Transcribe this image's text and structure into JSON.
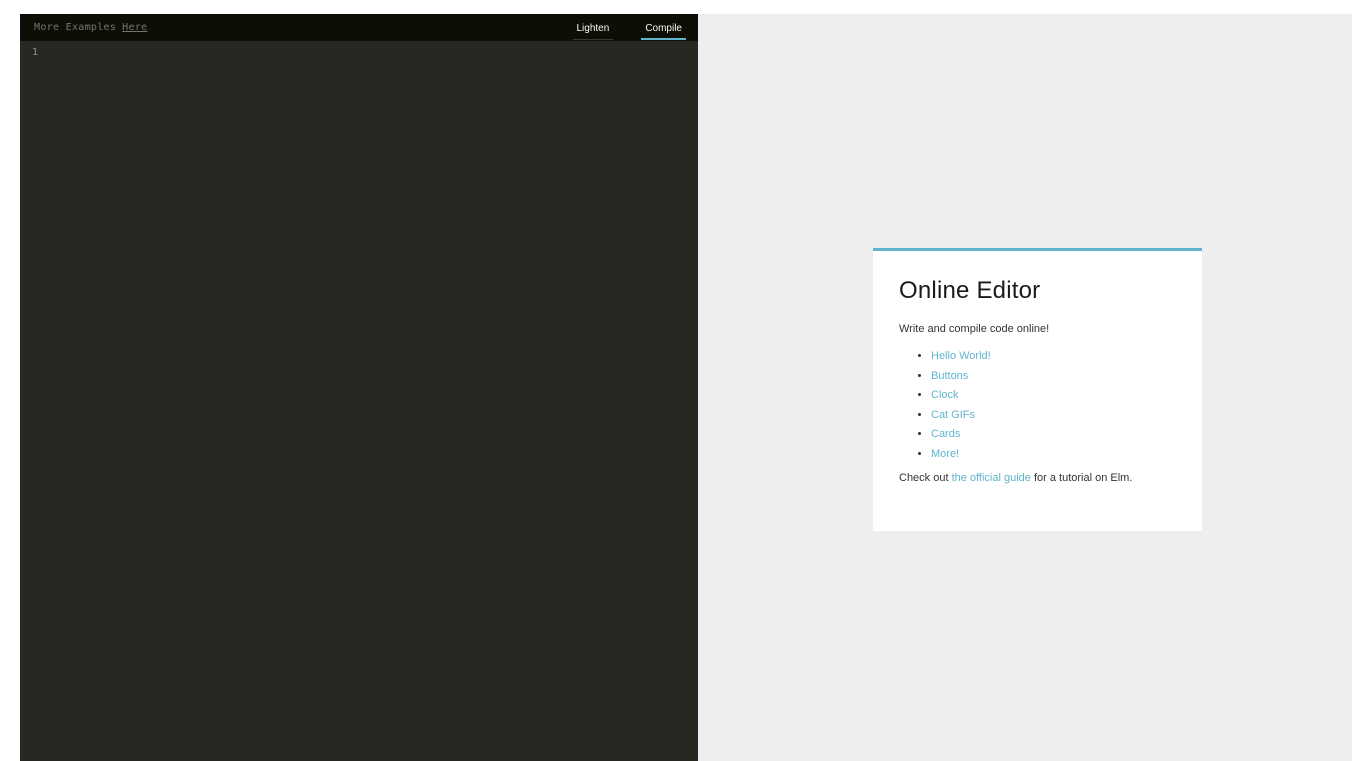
{
  "editor": {
    "hint": {
      "prefix": "More Examples",
      "link": "Here"
    },
    "buttons": {
      "lighten": "Lighten",
      "compile": "Compile"
    },
    "line_numbers": [
      "1"
    ]
  },
  "output": {
    "card": {
      "title": "Online Editor",
      "intro": "Write and compile code online!",
      "examples": [
        {
          "label": "Hello World!"
        },
        {
          "label": "Buttons"
        },
        {
          "label": "Clock"
        },
        {
          "label": "Cat GIFs"
        },
        {
          "label": "Cards"
        },
        {
          "label": "More!"
        }
      ],
      "outro_before": "Check out ",
      "outro_link": "the official guide",
      "outro_after": " for a tutorial on Elm."
    }
  },
  "colors": {
    "editor_bg": "#272822",
    "header_bg": "#0e0e06",
    "output_bg": "#eeeeee",
    "accent": "#60b5cc"
  }
}
